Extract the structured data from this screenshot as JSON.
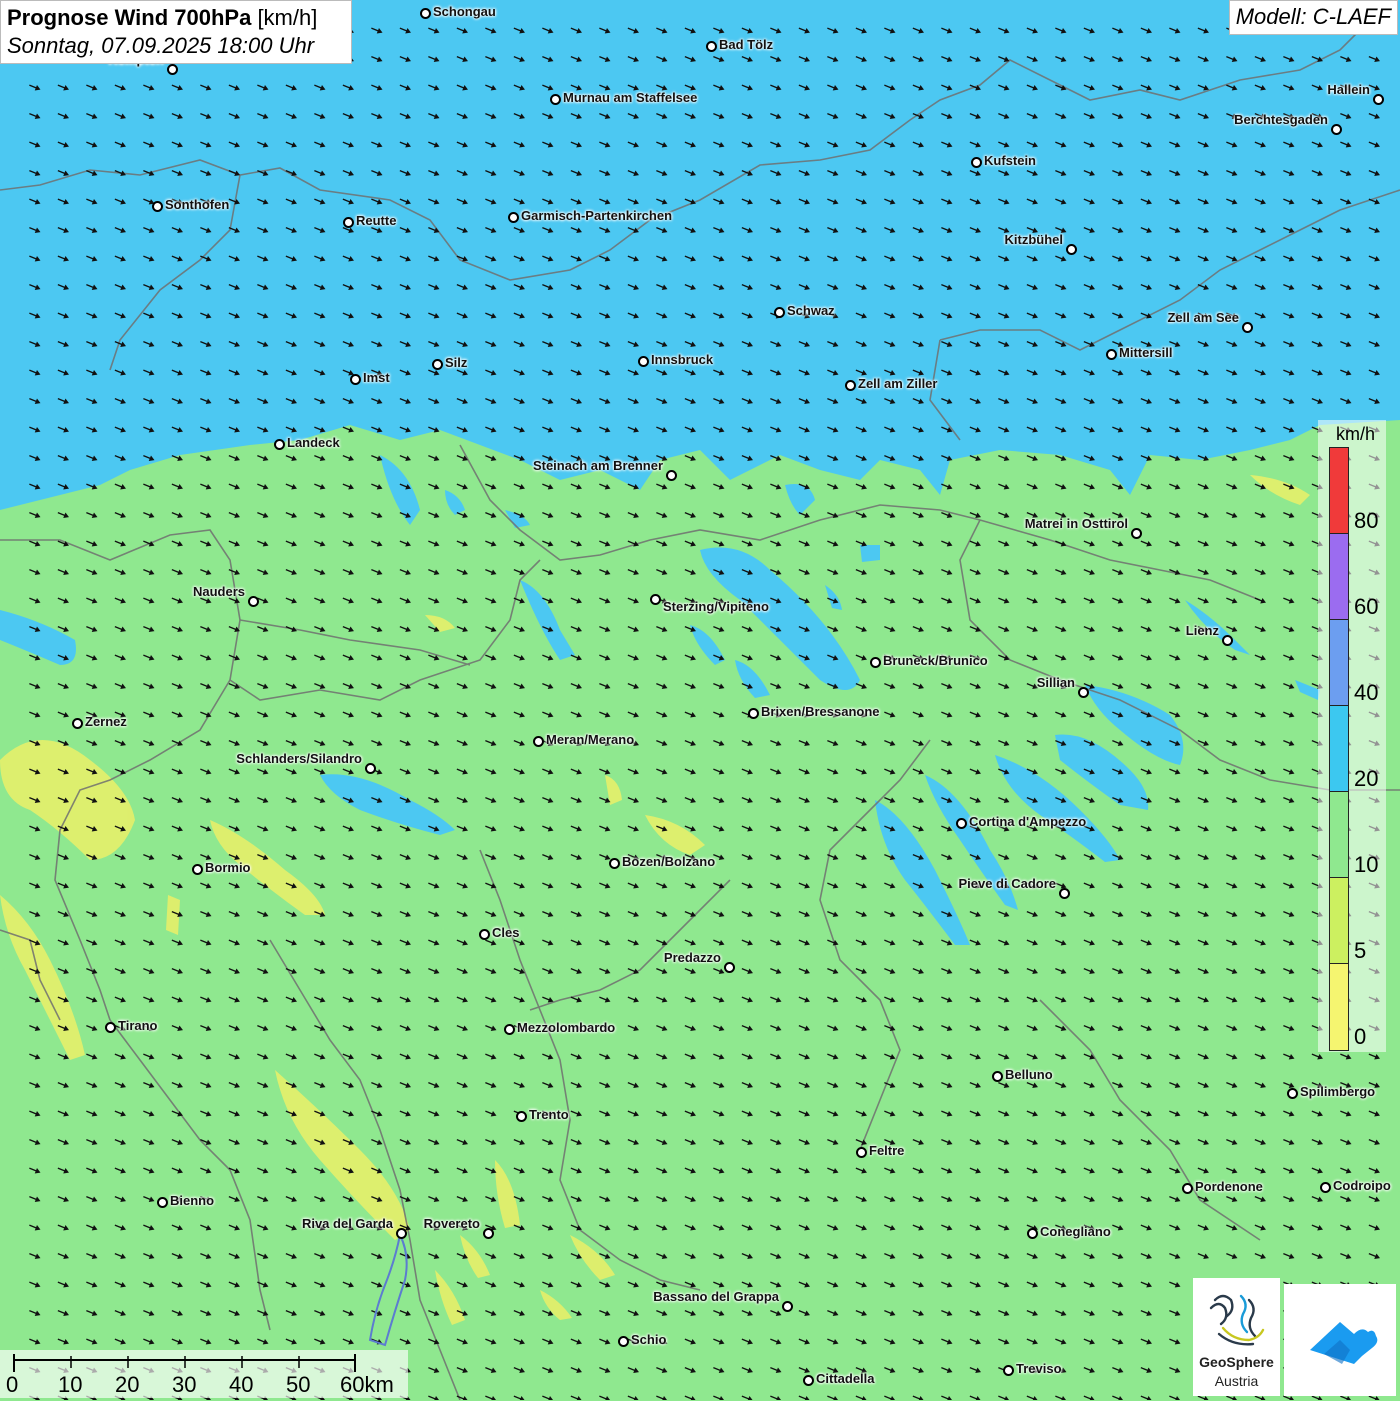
{
  "header": {
    "title": "Prognose Wind 700hPa",
    "unit": "[km/h]",
    "datetime": "Sonntag, 07.09.2025 18:00 Uhr",
    "model": "Modell: C-LAEF"
  },
  "legend": {
    "unit": "km/h",
    "ticks": [
      "80",
      "60",
      "40",
      "20",
      "10",
      "5",
      "0"
    ],
    "bands": [
      {
        "from": 80,
        "color": "#f03a3a"
      },
      {
        "from": 60,
        "color": "#9b6cf0"
      },
      {
        "from": 40,
        "color": "#6c9ef0"
      },
      {
        "from": 20,
        "color": "#3cc8f0"
      },
      {
        "from": 10,
        "color": "#8fe88f"
      },
      {
        "from": 5,
        "color": "#ccf060"
      },
      {
        "from": 0,
        "color": "#f5f570"
      }
    ]
  },
  "scalebar": {
    "ticks": [
      "0",
      "10",
      "20",
      "30",
      "40",
      "50",
      "60km"
    ]
  },
  "cities": [
    {
      "name": "Schongau"
    },
    {
      "name": "Bad Tölz"
    },
    {
      "name": "Kempten"
    },
    {
      "name": "Murnau am Staffelsee"
    },
    {
      "name": "Hallein"
    },
    {
      "name": "Berchtesgaden"
    },
    {
      "name": "Kufstein"
    },
    {
      "name": "Sonthofen"
    },
    {
      "name": "Reutte"
    },
    {
      "name": "Garmisch-Partenkirchen"
    },
    {
      "name": "Kitzbühel"
    },
    {
      "name": "Schwaz"
    },
    {
      "name": "Zell am See"
    },
    {
      "name": "Mittersill"
    },
    {
      "name": "Innsbruck"
    },
    {
      "name": "Silz"
    },
    {
      "name": "Imst"
    },
    {
      "name": "Zell am Ziller"
    },
    {
      "name": "Landeck"
    },
    {
      "name": "Steinach am Brenner"
    },
    {
      "name": "Matrei in Osttirol"
    },
    {
      "name": "Nauders"
    },
    {
      "name": "Sterzing/Vipiteno"
    },
    {
      "name": "Lienz"
    },
    {
      "name": "Bruneck/Brunico"
    },
    {
      "name": "Sillian"
    },
    {
      "name": "Brixen/Bressanone"
    },
    {
      "name": "Zernez"
    },
    {
      "name": "Meran/Merano"
    },
    {
      "name": "Schlanders/Silandro"
    },
    {
      "name": "Cortina d'Ampezzo"
    },
    {
      "name": "Bozen/Bolzano"
    },
    {
      "name": "Bormio"
    },
    {
      "name": "Pieve di Cadore"
    },
    {
      "name": "Cles"
    },
    {
      "name": "Predazzo"
    },
    {
      "name": "Tirano"
    },
    {
      "name": "Mezzolombardo"
    },
    {
      "name": "Belluno"
    },
    {
      "name": "Spilimbergo"
    },
    {
      "name": "Trento"
    },
    {
      "name": "Feltre"
    },
    {
      "name": "Pordenone"
    },
    {
      "name": "Codroipo"
    },
    {
      "name": "Bienno"
    },
    {
      "name": "Riva del Garda"
    },
    {
      "name": "Rovereto"
    },
    {
      "name": "Conegliano"
    },
    {
      "name": "Bassano del Grappa"
    },
    {
      "name": "Schio"
    },
    {
      "name": "Treviso"
    },
    {
      "name": "Cittadella"
    }
  ],
  "logos": {
    "geosphere_line1": "GeoSphere",
    "geosphere_line2": "Austria"
  }
}
